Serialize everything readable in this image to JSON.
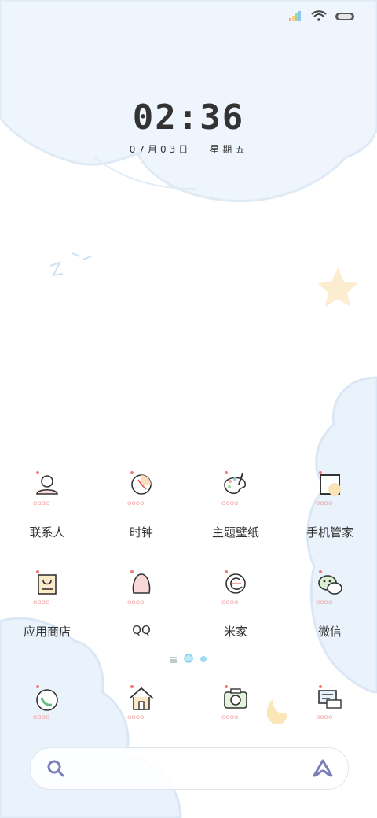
{
  "status": {
    "signal_icon": "signal-icon",
    "wifi_icon": "wifi-icon",
    "battery_icon": "battery-icon"
  },
  "lockscreen": {
    "time": "02:36",
    "date": "07月03日",
    "weekday": "星期五"
  },
  "apps_row1": [
    {
      "label": "联系人",
      "icon": "contacts-icon"
    },
    {
      "label": "时钟",
      "icon": "clock-icon"
    },
    {
      "label": "主题壁纸",
      "icon": "theme-palette-icon"
    },
    {
      "label": "手机管家",
      "icon": "phone-manager-icon"
    }
  ],
  "apps_row2": [
    {
      "label": "应用商店",
      "icon": "app-store-icon"
    },
    {
      "label": "QQ",
      "icon": "qq-icon"
    },
    {
      "label": "米家",
      "icon": "mijia-icon"
    },
    {
      "label": "微信",
      "icon": "wechat-icon"
    }
  ],
  "dock": [
    {
      "icon": "phone-icon"
    },
    {
      "icon": "browser-home-icon"
    },
    {
      "icon": "camera-icon"
    },
    {
      "icon": "messages-icon"
    }
  ],
  "search": {
    "search_icon": "search-icon",
    "assistant_icon": "assistant-icon"
  },
  "colors": {
    "cloud": "#e9f2fb",
    "cloud_outline": "#dbe8f5",
    "accent_blue": "#7fd3ee"
  }
}
